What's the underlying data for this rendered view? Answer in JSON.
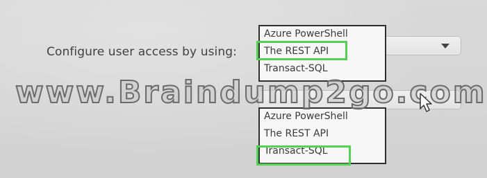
{
  "row1": {
    "label": "Configure user access by using:",
    "options": [
      "Azure PowerShell",
      "The REST API",
      "Transact-SQL"
    ],
    "selected": "The REST API"
  },
  "row2": {
    "options": [
      "Azure PowerShell",
      "The REST API",
      "Transact-SQL"
    ],
    "selected": "Transact-SQL"
  },
  "watermark": "www.Braindump2go.com",
  "colors": {
    "highlight": "#52d152",
    "list_border": "#2e2e2e",
    "background": "#d6d6d6"
  },
  "icons": {
    "combo_arrow": "chevron-down-icon",
    "cursor": "mouse-cursor-icon"
  }
}
